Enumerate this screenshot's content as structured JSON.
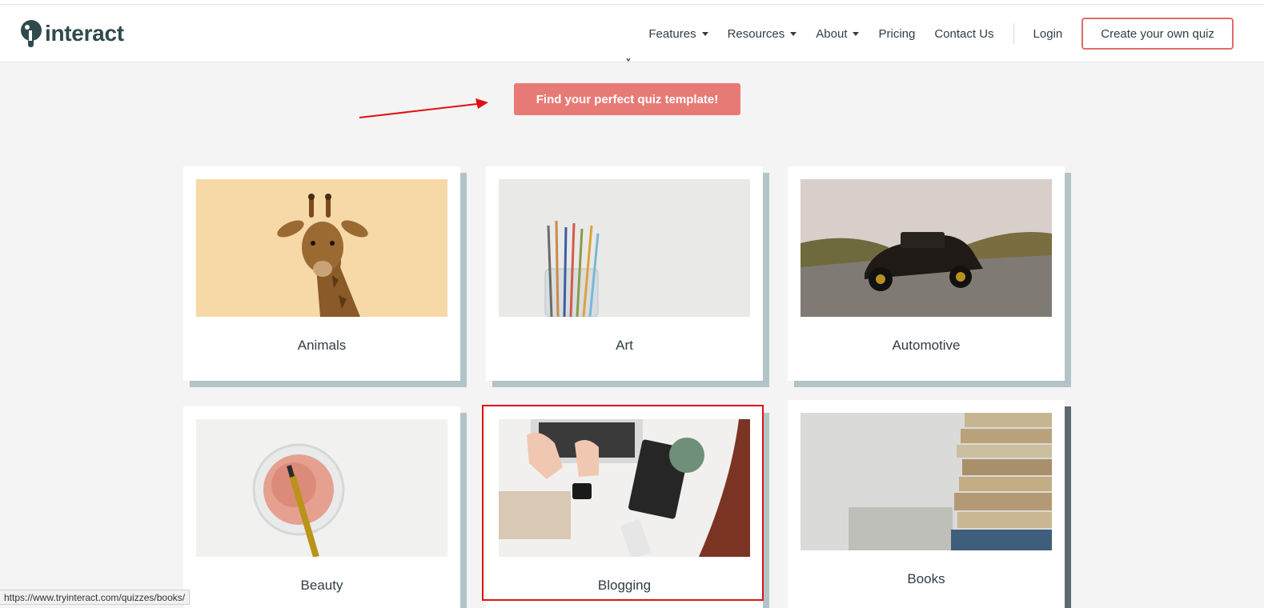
{
  "brand": {
    "name": "interact"
  },
  "nav": {
    "items": [
      {
        "label": "Features",
        "dropdown": true
      },
      {
        "label": "Resources",
        "dropdown": true
      },
      {
        "label": "About",
        "dropdown": true
      },
      {
        "label": "Pricing",
        "dropdown": false
      },
      {
        "label": "Contact Us",
        "dropdown": false
      }
    ],
    "login": "Login",
    "cta": "Create your own quiz"
  },
  "hero": {
    "button": "Find your perfect quiz template!"
  },
  "categories": [
    {
      "label": "Animals",
      "image": "giraffe"
    },
    {
      "label": "Art",
      "image": "paintbrushes-jar"
    },
    {
      "label": "Automotive",
      "image": "vintage-car"
    },
    {
      "label": "Beauty",
      "image": "makeup-powder-brush"
    },
    {
      "label": "Blogging",
      "image": "laptop-desk"
    },
    {
      "label": "Books",
      "image": "book-stack"
    }
  ],
  "status": {
    "url": "https://www.tryinteract.com/quizzes/books/"
  },
  "colors": {
    "accent": "#e87a76",
    "cta_border": "#e36b6b",
    "highlight": "#e01010",
    "card_shadow": "#b3c4c8",
    "text": "#2f3e46"
  }
}
